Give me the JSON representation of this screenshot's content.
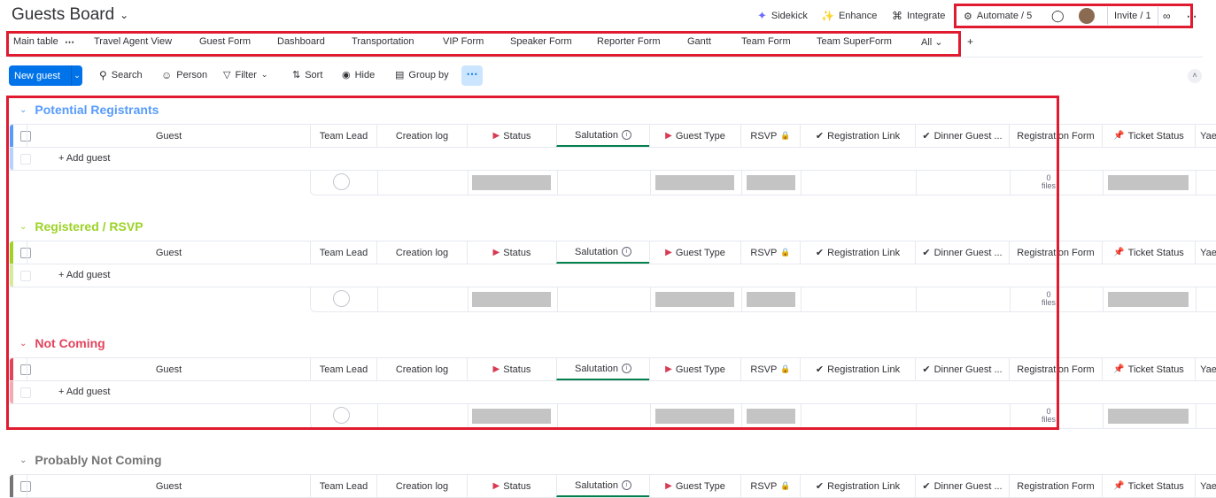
{
  "board": {
    "title": "Guests Board"
  },
  "topbar": {
    "sidekick": "Sidekick",
    "enhance": "Enhance",
    "integrate": "Integrate",
    "automate": "Automate / 5",
    "invite": "Invite / 1"
  },
  "tabs": [
    "Main table",
    "Travel Agent View",
    "Guest Form",
    "Dashboard",
    "Transportation",
    "VIP Form",
    "Speaker Form",
    "Reporter Form",
    "Gantt",
    "Team Form",
    "Team SuperForm",
    "All"
  ],
  "add_view": "+",
  "toolbar": {
    "new_item": "New guest",
    "search": "Search",
    "person": "Person",
    "filter": "Filter",
    "sort": "Sort",
    "hide": "Hide",
    "group_by": "Group by"
  },
  "columns": [
    "Guest",
    "Team Lead",
    "Creation log",
    "Status",
    "Salutation",
    "Guest Type",
    "RSVP",
    "Registration Link",
    "Dinner Guest ...",
    "Registration Form",
    "Ticket Status",
    "Yae"
  ],
  "add_item_label": "+ Add guest",
  "files_count": "0",
  "files_label": "files",
  "groups": [
    {
      "name": "Potential Registrants",
      "color": "#579bfc"
    },
    {
      "name": "Registered / RSVP",
      "color": "#9cd326"
    },
    {
      "name": "Not Coming",
      "color": "#e2445c"
    },
    {
      "name": "Probably Not Coming",
      "color": "#757575"
    }
  ]
}
